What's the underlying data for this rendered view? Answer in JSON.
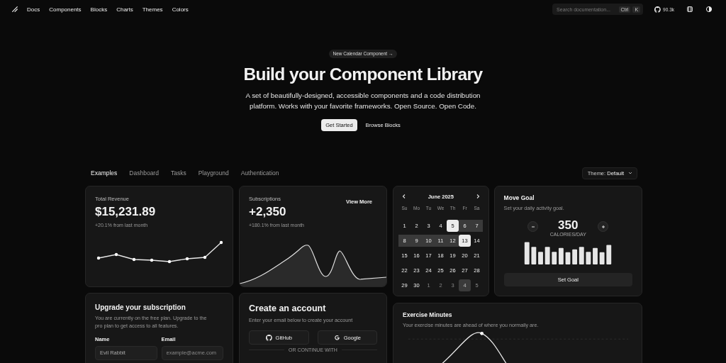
{
  "nav": {
    "links": [
      "Docs",
      "Components",
      "Blocks",
      "Charts",
      "Themes",
      "Colors"
    ]
  },
  "search": {
    "placeholder": "Search documentation...",
    "keys": [
      "Ctrl",
      "K"
    ]
  },
  "github_stars": "90.3k",
  "hero": {
    "badge": "New Calendar Component",
    "badge_arrow": "→",
    "title": "Build your Component Library",
    "subtitle": "A set of beautifully-designed, accessible components and a code distribution platform. Works with your favorite frameworks. Open Source. Open Code.",
    "buttons": [
      {
        "label": "Get Started",
        "kind": "primary"
      },
      {
        "label": "Browse Blocks",
        "kind": "ghost"
      }
    ]
  },
  "tabs": [
    {
      "label": "Examples",
      "selected": true
    },
    {
      "label": "Dashboard",
      "selected": false
    },
    {
      "label": "Tasks",
      "selected": false
    },
    {
      "label": "Playground",
      "selected": false
    },
    {
      "label": "Authentication",
      "selected": false
    }
  ],
  "theme": {
    "label": "Theme:",
    "value": "Default"
  },
  "revenue": {
    "title": "Total Revenue",
    "value": "$15,231.89",
    "change": "+20.1% from last month"
  },
  "subscriptions": {
    "title": "Subscriptions",
    "value": "+2,350",
    "change": "+180.1% from last month",
    "action": "View More"
  },
  "calendar": {
    "month": "June 2025",
    "weekdays": [
      "Su",
      "Mo",
      "Tu",
      "We",
      "Th",
      "Fr",
      "Sa"
    ],
    "days": [
      {
        "label": "1",
        "kind": "day",
        "selected": false
      },
      {
        "label": "2",
        "kind": "day",
        "selected": false
      },
      {
        "label": "3",
        "kind": "day",
        "selected": false
      },
      {
        "label": "4",
        "kind": "day",
        "selected": false
      },
      {
        "label": "5",
        "kind": "range",
        "selected": true
      },
      {
        "label": "6",
        "kind": "range",
        "selected": false
      },
      {
        "label": "7",
        "kind": "range",
        "selected": false
      },
      {
        "label": "8",
        "kind": "range",
        "selected": false
      },
      {
        "label": "9",
        "kind": "range",
        "selected": false
      },
      {
        "label": "10",
        "kind": "range",
        "selected": false
      },
      {
        "label": "11",
        "kind": "range",
        "selected": false
      },
      {
        "label": "12",
        "kind": "range",
        "selected": false
      },
      {
        "label": "13",
        "kind": "range",
        "selected": true
      },
      {
        "label": "14",
        "kind": "day",
        "selected": false
      },
      {
        "label": "15",
        "kind": "day",
        "selected": false
      },
      {
        "label": "16",
        "kind": "day",
        "selected": false
      },
      {
        "label": "17",
        "kind": "day",
        "selected": false
      },
      {
        "label": "18",
        "kind": "day",
        "selected": false
      },
      {
        "label": "19",
        "kind": "day",
        "selected": false
      },
      {
        "label": "20",
        "kind": "day",
        "selected": false
      },
      {
        "label": "21",
        "kind": "day",
        "selected": false
      },
      {
        "label": "22",
        "kind": "day",
        "selected": false
      },
      {
        "label": "23",
        "kind": "day",
        "selected": false
      },
      {
        "label": "24",
        "kind": "day",
        "selected": false
      },
      {
        "label": "25",
        "kind": "day",
        "selected": false
      },
      {
        "label": "26",
        "kind": "day",
        "selected": false
      },
      {
        "label": "27",
        "kind": "day",
        "selected": false
      },
      {
        "label": "28",
        "kind": "day",
        "selected": false
      },
      {
        "label": "29",
        "kind": "day",
        "selected": false
      },
      {
        "label": "30",
        "kind": "day",
        "selected": false
      },
      {
        "label": "1",
        "kind": "outside",
        "selected": false
      },
      {
        "label": "2",
        "kind": "outside",
        "selected": false
      },
      {
        "label": "3",
        "kind": "outside",
        "selected": false
      },
      {
        "label": "4",
        "kind": "marked",
        "selected": false
      },
      {
        "label": "5",
        "kind": "outside",
        "selected": false
      }
    ]
  },
  "move_goal": {
    "title": "Move Goal",
    "subtitle": "Set your daily activity goal.",
    "value": "350",
    "unit": "CALORIES/DAY",
    "button": "Set Goal"
  },
  "upgrade": {
    "title": "Upgrade your subscription",
    "description": "You are currently on the free plan. Upgrade to the pro plan to get access to all features.",
    "fields": [
      {
        "label": "Name",
        "value": "Evil Rabbit"
      },
      {
        "label": "Email",
        "placeholder": "example@acme.com"
      }
    ]
  },
  "create_account": {
    "title": "Create an account",
    "description": "Enter your email below to create your account",
    "buttons": [
      {
        "label": "GitHub",
        "kind": "github"
      },
      {
        "label": "Google",
        "kind": "google"
      }
    ],
    "divider": "OR CONTINUE WITH"
  },
  "exercise": {
    "title": "Exercise Minutes",
    "description": "Your exercise minutes are ahead of where you normally are."
  }
}
